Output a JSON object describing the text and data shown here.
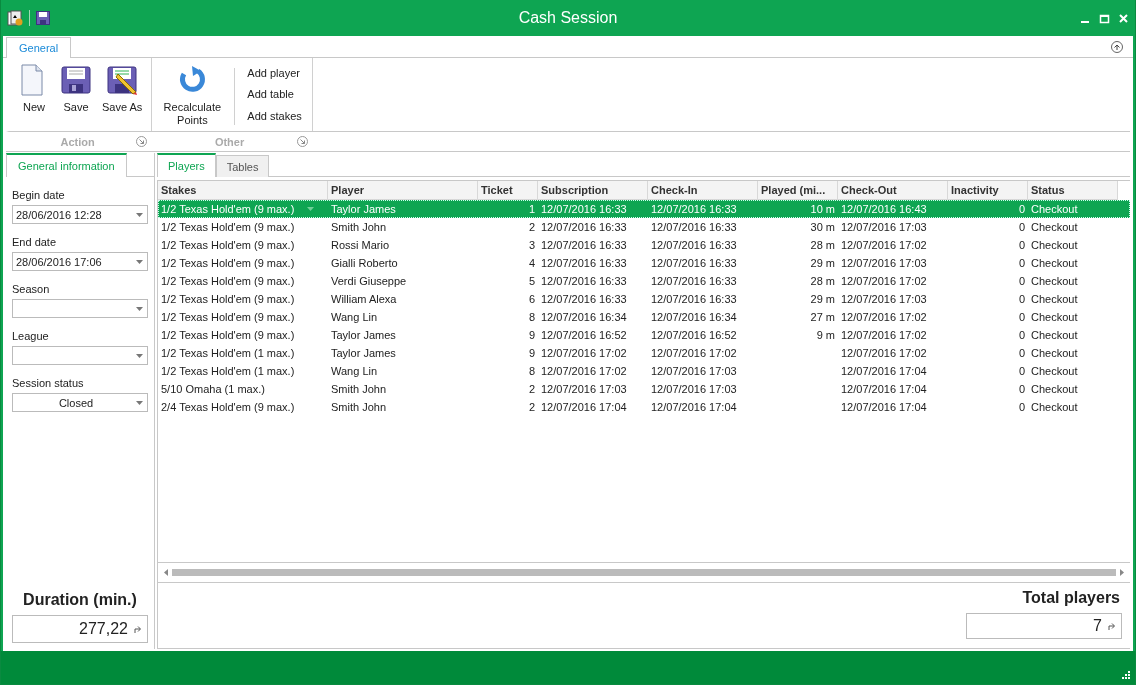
{
  "window": {
    "title": "Cash Session"
  },
  "ribbon": {
    "tabs": [
      {
        "label": "General",
        "selected": true
      }
    ],
    "groups": [
      {
        "label": "Action",
        "items": [
          {
            "label": "New",
            "kind": "large"
          },
          {
            "label": "Save",
            "kind": "large"
          },
          {
            "label": "Save As",
            "kind": "large"
          }
        ]
      },
      {
        "label": "Other",
        "items": [
          {
            "label": "Recalculate Points",
            "kind": "large"
          },
          {
            "label": "Add player",
            "kind": "small"
          },
          {
            "label": "Add table",
            "kind": "small"
          },
          {
            "label": "Add stakes",
            "kind": "small"
          }
        ]
      }
    ]
  },
  "sidebar": {
    "tabs": [
      {
        "label": "General information",
        "selected": true
      }
    ],
    "fields": [
      {
        "label": "Begin date",
        "value": "28/06/2016 12:28"
      },
      {
        "label": "End date",
        "value": "28/06/2016 17:06"
      },
      {
        "label": "Season"
      },
      {
        "label": "League"
      },
      {
        "label": "Session status",
        "value": "Closed"
      }
    ],
    "duration": {
      "label": "Duration (min.)",
      "value": "277,22"
    }
  },
  "main": {
    "tabs": [
      {
        "label": "Players",
        "selected": true
      },
      {
        "label": "Tables",
        "selected": false
      }
    ],
    "table": {
      "columns": [
        "Stakes",
        "Player",
        "Ticket",
        "Subscription",
        "Check-In",
        "Played (mi...",
        "Check-Out",
        "Inactivity",
        "Status"
      ],
      "rows": [
        {
          "stakes": "1/2 Texas Hold'em (9 max.)",
          "player": "Taylor James",
          "ticket": "1",
          "subscription": "12/07/2016 16:33",
          "check_in": "12/07/2016 16:33",
          "played": "10 m",
          "check_out": "12/07/2016 16:43",
          "inactivity": "0",
          "status": "Checkout",
          "selected": true
        },
        {
          "stakes": "1/2 Texas Hold'em (9 max.)",
          "player": "Smith John",
          "ticket": "2",
          "subscription": "12/07/2016 16:33",
          "check_in": "12/07/2016 16:33",
          "played": "30 m",
          "check_out": "12/07/2016 17:03",
          "inactivity": "0",
          "status": "Checkout",
          "selected": false
        },
        {
          "stakes": "1/2 Texas Hold'em (9 max.)",
          "player": "Rossi Mario",
          "ticket": "3",
          "subscription": "12/07/2016 16:33",
          "check_in": "12/07/2016 16:33",
          "played": "28 m",
          "check_out": "12/07/2016 17:02",
          "inactivity": "0",
          "status": "Checkout",
          "selected": false
        },
        {
          "stakes": "1/2 Texas Hold'em (9 max.)",
          "player": "Gialli Roberto",
          "ticket": "4",
          "subscription": "12/07/2016 16:33",
          "check_in": "12/07/2016 16:33",
          "played": "29 m",
          "check_out": "12/07/2016 17:03",
          "inactivity": "0",
          "status": "Checkout",
          "selected": false
        },
        {
          "stakes": "1/2 Texas Hold'em (9 max.)",
          "player": "Verdi Giuseppe",
          "ticket": "5",
          "subscription": "12/07/2016 16:33",
          "check_in": "12/07/2016 16:33",
          "played": "28 m",
          "check_out": "12/07/2016 17:02",
          "inactivity": "0",
          "status": "Checkout",
          "selected": false
        },
        {
          "stakes": "1/2 Texas Hold'em (9 max.)",
          "player": "William Alexa",
          "ticket": "6",
          "subscription": "12/07/2016 16:33",
          "check_in": "12/07/2016 16:33",
          "played": "29 m",
          "check_out": "12/07/2016 17:03",
          "inactivity": "0",
          "status": "Checkout",
          "selected": false
        },
        {
          "stakes": "1/2 Texas Hold'em (9 max.)",
          "player": "Wang Lin",
          "ticket": "8",
          "subscription": "12/07/2016 16:34",
          "check_in": "12/07/2016 16:34",
          "played": "27 m",
          "check_out": "12/07/2016 17:02",
          "inactivity": "0",
          "status": "Checkout",
          "selected": false
        },
        {
          "stakes": "1/2 Texas Hold'em (9 max.)",
          "player": "Taylor James",
          "ticket": "9",
          "subscription": "12/07/2016 16:52",
          "check_in": "12/07/2016 16:52",
          "played": "9 m",
          "check_out": "12/07/2016 17:02",
          "inactivity": "0",
          "status": "Checkout",
          "selected": false
        },
        {
          "stakes": "1/2 Texas Hold'em (1 max.)",
          "player": "Taylor James",
          "ticket": "9",
          "subscription": "12/07/2016 17:02",
          "check_in": "12/07/2016 17:02",
          "check_out": "12/07/2016 17:02",
          "inactivity": "0",
          "status": "Checkout",
          "selected": false
        },
        {
          "stakes": "1/2 Texas Hold'em (1 max.)",
          "player": "Wang Lin",
          "ticket": "8",
          "subscription": "12/07/2016 17:02",
          "check_in": "12/07/2016 17:03",
          "check_out": "12/07/2016 17:04",
          "inactivity": "0",
          "status": "Checkout",
          "selected": false
        },
        {
          "stakes": "5/10 Omaha (1 max.)",
          "player": "Smith John",
          "ticket": "2",
          "subscription": "12/07/2016 17:03",
          "check_in": "12/07/2016 17:03",
          "check_out": "12/07/2016 17:04",
          "inactivity": "0",
          "status": "Checkout",
          "selected": false
        },
        {
          "stakes": "2/4 Texas Hold'em (9 max.)",
          "player": "Smith John",
          "ticket": "2",
          "subscription": "12/07/2016 17:04",
          "check_in": "12/07/2016 17:04",
          "check_out": "12/07/2016 17:04",
          "inactivity": "0",
          "status": "Checkout",
          "selected": false
        }
      ]
    },
    "total": {
      "label": "Total players",
      "value": "7"
    }
  }
}
